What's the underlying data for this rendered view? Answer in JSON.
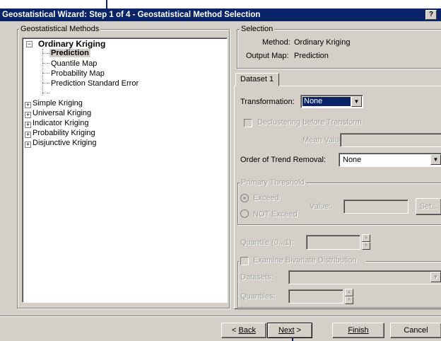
{
  "window": {
    "title": "Geostatistical Wizard: Step 1 of 4 - Geostatistical Method Selection",
    "help": "?"
  },
  "methods": {
    "group_label": "Geostatistical Methods",
    "ordinary": "Ordinary Kriging",
    "ordinary_children": [
      "Prediction",
      "Quantile Map",
      "Probability Map",
      "Prediction Standard Error"
    ],
    "others": [
      "Simple Kriging",
      "Universal Kriging",
      "Indicator Kriging",
      "Probability Kriging",
      "Disjunctive Kriging"
    ]
  },
  "selection": {
    "group_label": "Selection",
    "method_label": "Method:",
    "method_value": "Ordinary Kriging",
    "output_label": "Output Map:",
    "output_value": "Prediction"
  },
  "dataset": {
    "tab": "Dataset 1",
    "transformation_label": "Transformation:",
    "transformation_value": "None",
    "declustering_label": "Declustering before Transform",
    "mean_value_label": "Mean Value:",
    "trend_label": "Order of Trend Removal:",
    "trend_value": "None"
  },
  "threshold": {
    "group_label": "Primary Threshold",
    "exceed": "Exceed",
    "not_exceed": "NOT Exceed",
    "value_label": "Value:",
    "set_button": "Set..."
  },
  "quantile": {
    "label": "Quantile (0...1):"
  },
  "bivariate": {
    "label": "Examine Bivariate Distribution",
    "datasets_label": "Datasets:",
    "quantiles_label": "Quantiles:"
  },
  "buttons": {
    "back": "Back",
    "next": "Next",
    "finish": "Finish",
    "cancel": "Cancel"
  },
  "colors": {
    "titlebar": "#0a246a",
    "face": "#d4d0c8",
    "disabled_text": "#a0a0a0"
  }
}
